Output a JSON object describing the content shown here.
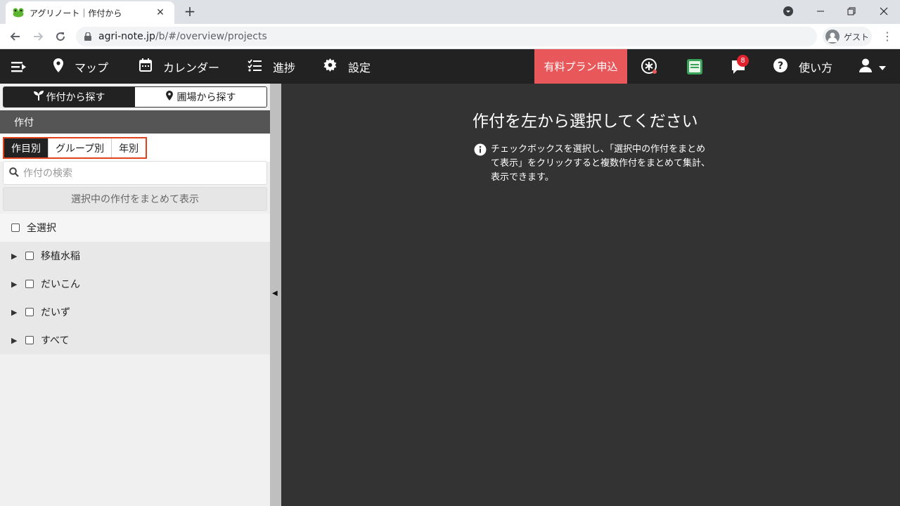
{
  "browser": {
    "tab_title": "アグリノート｜作付から",
    "url_host": "agri-note.jp",
    "url_path": "/b/#/overview/projects",
    "profile_label": "ゲスト"
  },
  "header": {
    "nav": [
      {
        "label": "マップ"
      },
      {
        "label": "カレンダー"
      },
      {
        "label": "進捗"
      },
      {
        "label": "設定"
      }
    ],
    "premium_label": "有料プラン申込",
    "notification_count": "8",
    "help_label": "使い方"
  },
  "sidebar": {
    "mode_tabs": [
      {
        "label": "作付から探す",
        "active": true
      },
      {
        "label": "圃場から探す",
        "active": false
      }
    ],
    "section_title": "作付",
    "sub_tabs": [
      {
        "label": "作目別",
        "active": true
      },
      {
        "label": "グループ別",
        "active": false
      },
      {
        "label": "年別",
        "active": false
      }
    ],
    "search_placeholder": "作付の検索",
    "bulk_button_label": "選択中の作付をまとめて表示",
    "select_all_label": "全選択",
    "crops": [
      {
        "label": "移植水稲"
      },
      {
        "label": "だいこん"
      },
      {
        "label": "だいず"
      },
      {
        "label": "すべて"
      }
    ]
  },
  "main": {
    "title": "作付を左から選択してください",
    "info_text": "チェックボックスを選択し、「選択中の作付をまとめて表示」をクリックすると複数作付をまとめて集計、表示できます。"
  },
  "colors": {
    "header_bg": "#222222",
    "premium_bg": "#e8585b",
    "highlight_border": "#e0421e",
    "main_bg": "#333333"
  }
}
